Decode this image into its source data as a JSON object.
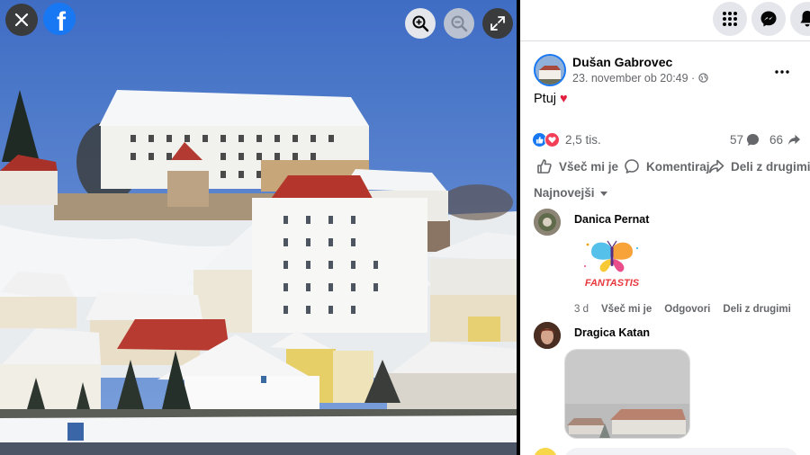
{
  "viewer": {
    "close_icon": "close-icon",
    "logo_letter": "f",
    "zoom_in_icon": "zoom-in-icon",
    "zoom_out_icon": "zoom-out-icon",
    "expand_icon": "expand-icon"
  },
  "topbar": {
    "icons": [
      "menu-grid-icon",
      "messenger-icon",
      "bell-icon"
    ]
  },
  "post": {
    "author": "Dušan Gabrovec",
    "timestamp": "23. november ob 20:49 · ",
    "privacy_icon": "globe-icon",
    "text": "Ptuj ",
    "text_emoji": "♥",
    "reactions_count": "2,5 tis.",
    "comments_count": "57",
    "shares_count": "66"
  },
  "actions": {
    "like": "Všeč mi je",
    "comment": "Komentiraj",
    "share": "Deli z drugimi"
  },
  "sort_label": "Najnovejši",
  "comments": [
    {
      "name": "Danica Pernat",
      "sticker_text": "FANTASTIS",
      "time": "3 d",
      "like": "Všeč mi je",
      "reply": "Odgovori",
      "share": "Deli z drugimi"
    },
    {
      "name": "Dragica Katan"
    }
  ],
  "colors": {
    "brand": "#1877f2",
    "love": "#f33e58",
    "secondary_text": "#65676b"
  }
}
